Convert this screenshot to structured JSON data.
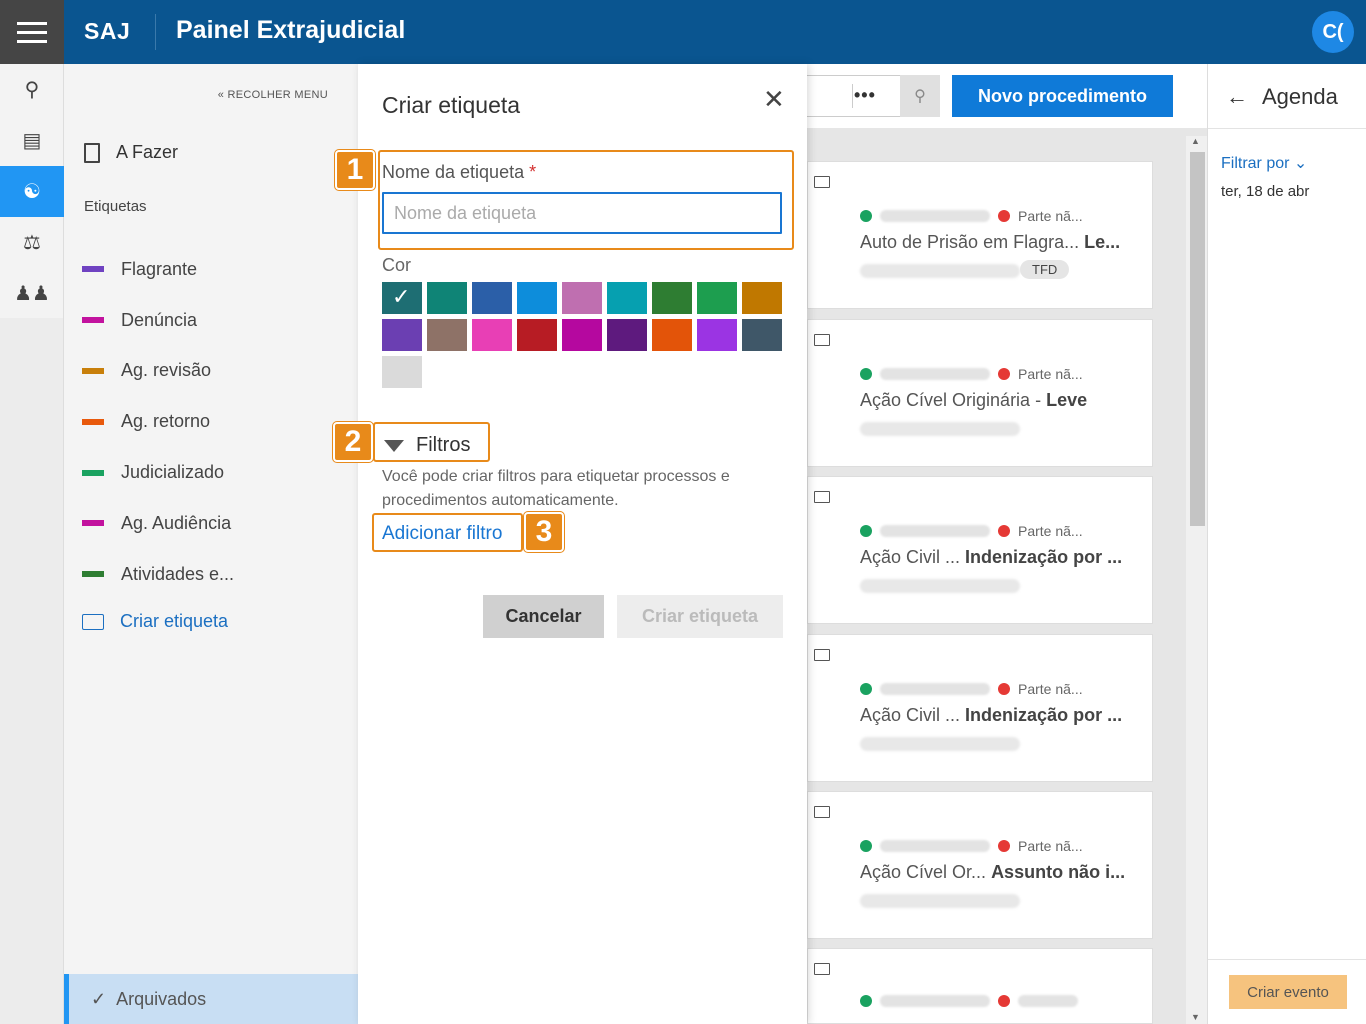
{
  "header": {
    "brand": "SAJ",
    "title": "Painel Extrajudicial",
    "user_initials": "C("
  },
  "sidebar": {
    "collapse_label": "RECOLHER MENU",
    "todo_label": "A Fazer",
    "tags_section": "Etiquetas",
    "tags": [
      {
        "label": "Flagrante",
        "color": "#6f42c1"
      },
      {
        "label": "Denúncia",
        "color": "#c2129e"
      },
      {
        "label": "Ag. revisão",
        "color": "#c87f0a"
      },
      {
        "label": "Ag. retorno",
        "color": "#e8590c"
      },
      {
        "label": "Judicializado",
        "color": "#1aa260"
      },
      {
        "label": "Ag. Audiência",
        "color": "#c2129e"
      },
      {
        "label": "Atividades e...",
        "color": "#2e7d32"
      }
    ],
    "create_tag_label": "Criar etiqueta",
    "archived_label": "Arquivados"
  },
  "toolbar": {
    "more_label": "•••",
    "new_procedure_label": "Novo procedimento"
  },
  "cards": [
    {
      "status": "Parte nã...",
      "title": "Auto de Prisão em Flagra...",
      "subject": "Le...",
      "badge": "TFD"
    },
    {
      "status": "Parte nã...",
      "title": "Ação Cível Originária -",
      "subject": "Leve",
      "badge": ""
    },
    {
      "status": "Parte nã...",
      "title": "Ação Civil ...",
      "subject": "Indenização por ...",
      "badge": ""
    },
    {
      "status": "Parte nã...",
      "title": "Ação Civil ...",
      "subject": "Indenização por ...",
      "badge": ""
    },
    {
      "status": "Parte nã...",
      "title": "Ação Cível Or...",
      "subject": "Assunto não i...",
      "badge": ""
    },
    {
      "status": "",
      "title": "",
      "subject": "",
      "badge": ""
    }
  ],
  "agenda": {
    "title": "Agenda",
    "filter_label": "Filtrar por",
    "date": "ter, 18 de abr",
    "create_event_label": "Criar evento"
  },
  "modal": {
    "title": "Criar etiqueta",
    "name_label": "Nome da etiqueta",
    "required_mark": "*",
    "name_value": "",
    "name_placeholder": "Nome da etiqueta",
    "color_label": "Cor",
    "colors": [
      "#1e6e73",
      "#0f8476",
      "#2b5fa8",
      "#0d8ddb",
      "#bf6fb0",
      "#06a0b0",
      "#2e7d32",
      "#1d9e4f",
      "#c07800",
      "#6b3fb2",
      "#8e7267",
      "#e83fb5",
      "#b71c24",
      "#b5089f",
      "#5e1a7e",
      "#e35409",
      "#9b34e3",
      "#3f5768",
      "#dadada"
    ],
    "filters_title": "Filtros",
    "filters_description": "Você pode criar filtros para etiquetar processos e procedimentos automaticamente.",
    "add_filter_label": "Adicionar filtro",
    "cancel_label": "Cancelar",
    "create_label": "Criar etiqueta"
  },
  "annotations": [
    "1",
    "2",
    "3"
  ],
  "accent_color": "#e88a1a"
}
